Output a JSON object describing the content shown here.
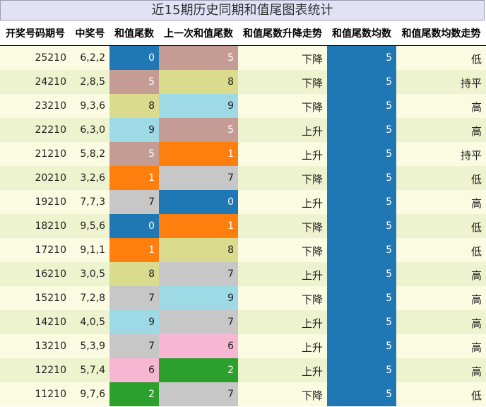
{
  "title": "近15期历史同期和值尾图表统计",
  "headers": [
    "开奖号码期号",
    "中奖号",
    "和值尾数",
    "上一次和值尾数",
    "和值尾数升降走势",
    "和值尾数均数",
    "和值尾数均数走势"
  ],
  "colors": {
    "0": "#1f77b4",
    "1": "#ff7f0e",
    "2": "#2ca02c",
    "5": "#c49c94",
    "6": "#f7b6d2",
    "7": "#c7c7c7",
    "8": "#dbdb8d",
    "9": "#9edae5"
  },
  "rows": [
    {
      "period": "25210",
      "numbers": "6,2,2",
      "tail": "0",
      "prev_tail": "5",
      "trend": "下降",
      "avg": "5",
      "avg_trend": "低"
    },
    {
      "period": "24210",
      "numbers": "2,8,5",
      "tail": "5",
      "prev_tail": "8",
      "trend": "下降",
      "avg": "5",
      "avg_trend": "持平"
    },
    {
      "period": "23210",
      "numbers": "9,3,6",
      "tail": "8",
      "prev_tail": "9",
      "trend": "下降",
      "avg": "5",
      "avg_trend": "高"
    },
    {
      "period": "22210",
      "numbers": "6,3,0",
      "tail": "9",
      "prev_tail": "5",
      "trend": "上升",
      "avg": "5",
      "avg_trend": "高"
    },
    {
      "period": "21210",
      "numbers": "5,8,2",
      "tail": "5",
      "prev_tail": "1",
      "trend": "上升",
      "avg": "5",
      "avg_trend": "持平"
    },
    {
      "period": "20210",
      "numbers": "3,2,6",
      "tail": "1",
      "prev_tail": "7",
      "trend": "下降",
      "avg": "5",
      "avg_trend": "低"
    },
    {
      "period": "19210",
      "numbers": "7,7,3",
      "tail": "7",
      "prev_tail": "0",
      "trend": "上升",
      "avg": "5",
      "avg_trend": "高"
    },
    {
      "period": "18210",
      "numbers": "9,5,6",
      "tail": "0",
      "prev_tail": "1",
      "trend": "下降",
      "avg": "5",
      "avg_trend": "低"
    },
    {
      "period": "17210",
      "numbers": "9,1,1",
      "tail": "1",
      "prev_tail": "8",
      "trend": "下降",
      "avg": "5",
      "avg_trend": "低"
    },
    {
      "period": "16210",
      "numbers": "3,0,5",
      "tail": "8",
      "prev_tail": "7",
      "trend": "上升",
      "avg": "5",
      "avg_trend": "高"
    },
    {
      "period": "15210",
      "numbers": "7,2,8",
      "tail": "7",
      "prev_tail": "9",
      "trend": "下降",
      "avg": "5",
      "avg_trend": "高"
    },
    {
      "period": "14210",
      "numbers": "4,0,5",
      "tail": "9",
      "prev_tail": "7",
      "trend": "上升",
      "avg": "5",
      "avg_trend": "高"
    },
    {
      "period": "13210",
      "numbers": "5,3,9",
      "tail": "7",
      "prev_tail": "6",
      "trend": "上升",
      "avg": "5",
      "avg_trend": "高"
    },
    {
      "period": "12210",
      "numbers": "5,7,4",
      "tail": "6",
      "prev_tail": "2",
      "trend": "上升",
      "avg": "5",
      "avg_trend": "高"
    },
    {
      "period": "11210",
      "numbers": "9,7,6",
      "tail": "2",
      "prev_tail": "7",
      "trend": "下降",
      "avg": "5",
      "avg_trend": "低"
    }
  ]
}
